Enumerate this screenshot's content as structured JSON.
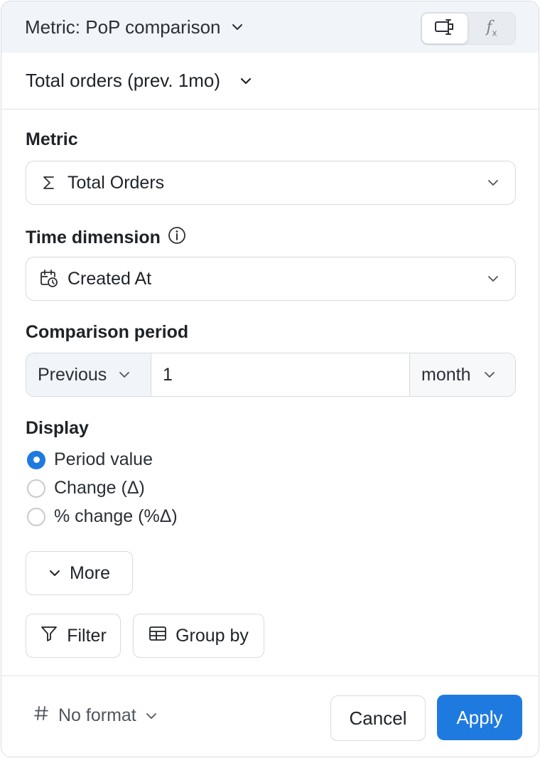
{
  "header": {
    "title": "Metric: PoP comparison",
    "mode_icons": [
      "card-icon",
      "formula-icon"
    ],
    "formula_label": "f",
    "formula_sub": "x"
  },
  "metric_name": "Total orders (prev. 1mo)",
  "metric": {
    "label": "Metric",
    "value": "Total Orders",
    "icon": "sigma-icon"
  },
  "time_dimension": {
    "label": "Time dimension",
    "value": "Created At",
    "icon": "calendar-clock-icon"
  },
  "comparison_period": {
    "label": "Comparison period",
    "direction": "Previous",
    "amount": "1",
    "unit": "month"
  },
  "display": {
    "label": "Display",
    "options": [
      "Period value",
      "Change (Δ)",
      "% change (%Δ)"
    ],
    "selected": "Period value"
  },
  "more_label": "More",
  "filter_label": "Filter",
  "group_by_label": "Group by",
  "footer": {
    "format_label": "No format",
    "cancel_label": "Cancel",
    "apply_label": "Apply"
  },
  "colors": {
    "accent": "#1f7ae0",
    "header_bg": "#f1f4f8"
  }
}
